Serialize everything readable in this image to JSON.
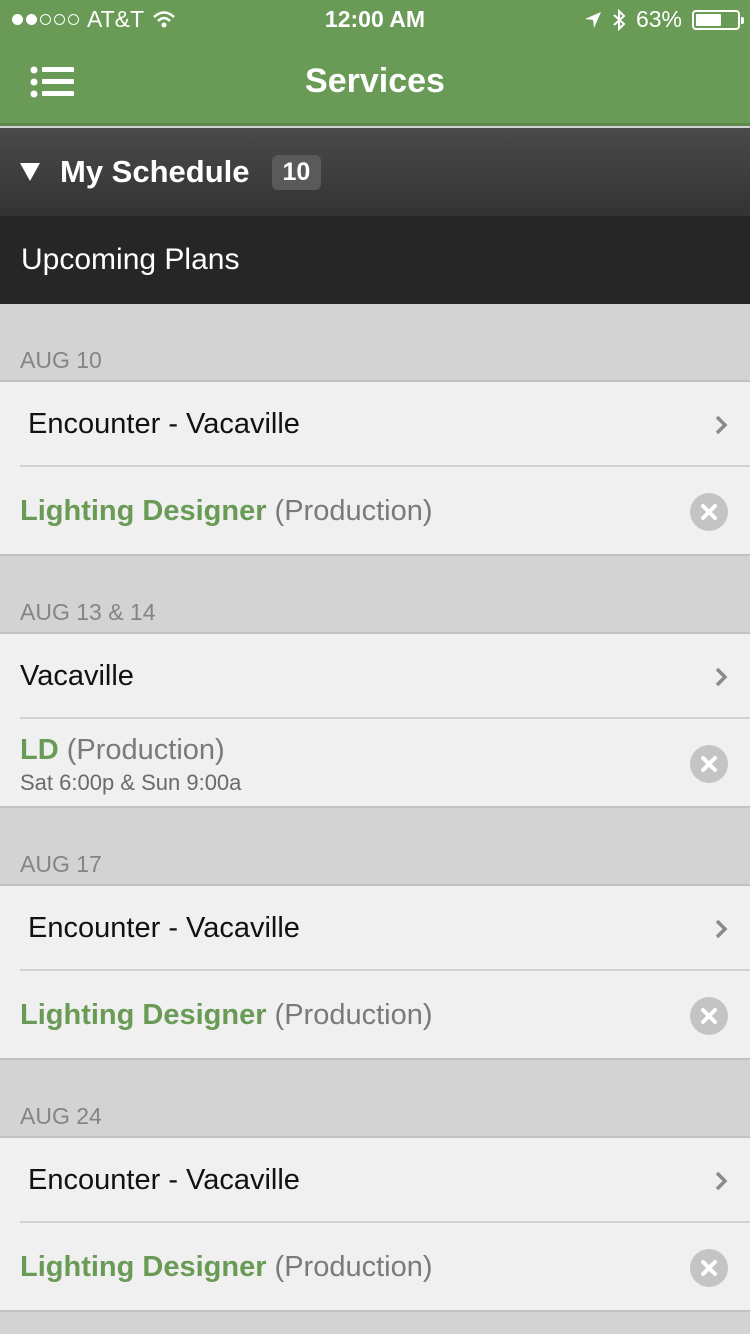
{
  "status": {
    "carrier": "AT&T",
    "time": "12:00 AM",
    "battery_percent": "63%",
    "battery_level": 0.63
  },
  "nav": {
    "title": "Services"
  },
  "schedule": {
    "label": "My Schedule",
    "count": "10"
  },
  "upcoming": {
    "label": "Upcoming Plans"
  },
  "groups": [
    {
      "date": "AUG 10",
      "plan": " Encounter - Vacaville",
      "role": "Lighting Designer",
      "team": " (Production)",
      "times": ""
    },
    {
      "date": "AUG 13 & 14",
      "plan": "Vacaville",
      "role": "LD",
      "team": " (Production)",
      "times": "Sat 6:00p & Sun 9:00a"
    },
    {
      "date": "AUG 17",
      "plan": " Encounter - Vacaville",
      "role": "Lighting Designer",
      "team": " (Production)",
      "times": ""
    },
    {
      "date": "AUG 24",
      "plan": " Encounter - Vacaville",
      "role": "Lighting Designer",
      "team": " (Production)",
      "times": ""
    }
  ],
  "colors": {
    "brand_green": "#6a9b56",
    "dark_header": "#262626"
  }
}
